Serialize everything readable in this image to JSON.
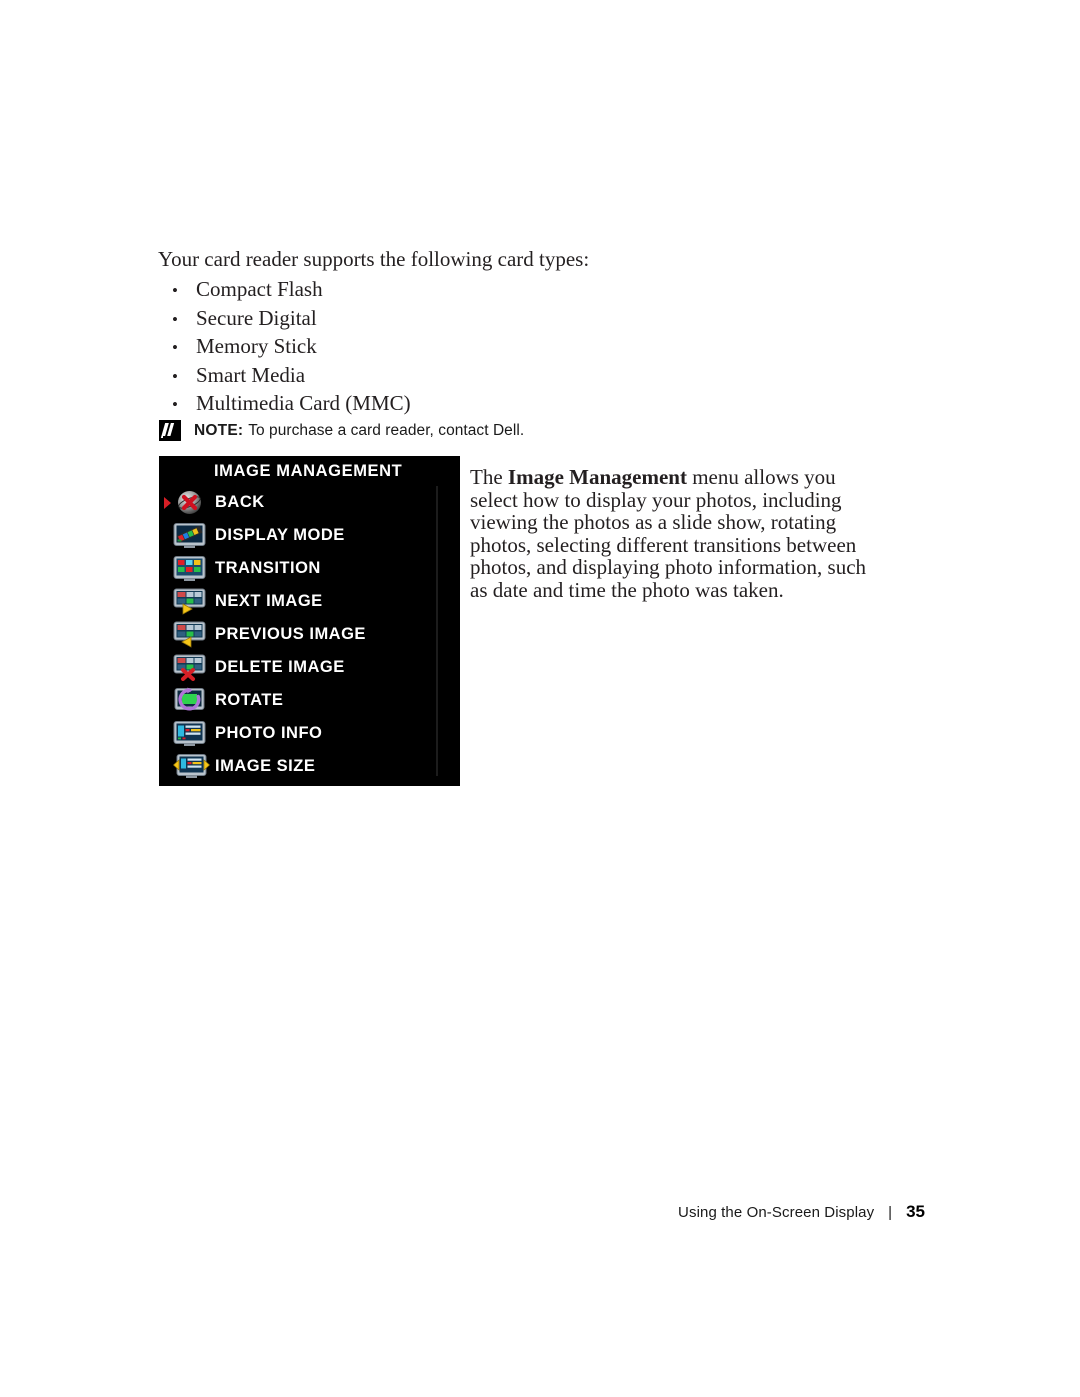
{
  "document": {
    "intro_line": "Your card reader supports the following card types:",
    "card_types": [
      "Compact Flash",
      "Secure Digital",
      "Memory Stick",
      "Smart Media",
      "Multimedia Card (MMC)"
    ],
    "bullet_glyph": "•",
    "note": {
      "icon": "note-pencil-icon",
      "label": "NOTE:",
      "text": "To purchase a card reader, contact Dell."
    },
    "description": {
      "lead": "The ",
      "bold_term": "Image Management",
      "rest": " menu allows you select how to display your photos, including viewing the photos as a slide show, rotating photos, selecting different transitions between photos, and displaying photo information, such as date and time the photo was taken."
    }
  },
  "osd": {
    "title": "IMAGE MANAGEMENT",
    "background_color": "#000000",
    "text_color": "#ffffff",
    "selection_marker_color": "#d81f26",
    "selected_index": 0,
    "items": [
      {
        "label": "BACK",
        "icon": "back-cancel-icon",
        "selected": true
      },
      {
        "label": "DISPLAY MODE",
        "icon": "display-mode-filmstrip-icon",
        "selected": false
      },
      {
        "label": "TRANSITION",
        "icon": "transition-grid-icon",
        "selected": false
      },
      {
        "label": "NEXT IMAGE",
        "icon": "next-image-arrow-icon",
        "selected": false
      },
      {
        "label": "PREVIOUS IMAGE",
        "icon": "previous-image-arrow-icon",
        "selected": false
      },
      {
        "label": "DELETE IMAGE",
        "icon": "delete-image-x-icon",
        "selected": false
      },
      {
        "label": "ROTATE",
        "icon": "rotate-circular-arrow-icon",
        "selected": false
      },
      {
        "label": "PHOTO INFO",
        "icon": "photo-info-icon",
        "selected": false
      },
      {
        "label": "IMAGE SIZE",
        "icon": "image-size-arrows-icon",
        "selected": false
      }
    ]
  },
  "footer": {
    "section": "Using the On-Screen Display",
    "separator": "|",
    "page_number": "35"
  }
}
